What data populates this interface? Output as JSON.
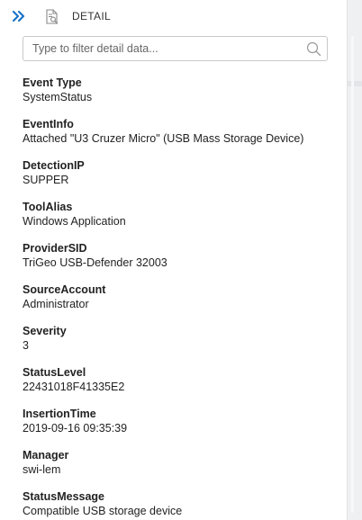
{
  "header": {
    "title": "DETAIL"
  },
  "filter": {
    "placeholder": "Type to filter detail data...",
    "value": ""
  },
  "fields": [
    {
      "label": "Event Type",
      "value": "SystemStatus"
    },
    {
      "label": "EventInfo",
      "value": "Attached \"U3 Cruzer Micro\" (USB Mass Storage Device)"
    },
    {
      "label": "DetectionIP",
      "value": "SUPPER"
    },
    {
      "label": "ToolAlias",
      "value": "Windows Application"
    },
    {
      "label": "ProviderSID",
      "value": "TriGeo USB-Defender 32003"
    },
    {
      "label": "SourceAccount",
      "value": "Administrator"
    },
    {
      "label": "Severity",
      "value": "3"
    },
    {
      "label": "StatusLevel",
      "value": "22431018F41335E2"
    },
    {
      "label": "InsertionTime",
      "value": "2019-09-16 09:35:39"
    },
    {
      "label": "Manager",
      "value": "swi-lem"
    },
    {
      "label": "StatusMessage",
      "value": "Compatible USB storage device"
    }
  ],
  "colors": {
    "accent": "#1a73c8",
    "icon": "#8a8a8a",
    "border": "#c9c9c9"
  },
  "icons": {
    "collapse": "double-chevron-right-icon",
    "detail": "document-search-icon",
    "search": "search-icon"
  }
}
